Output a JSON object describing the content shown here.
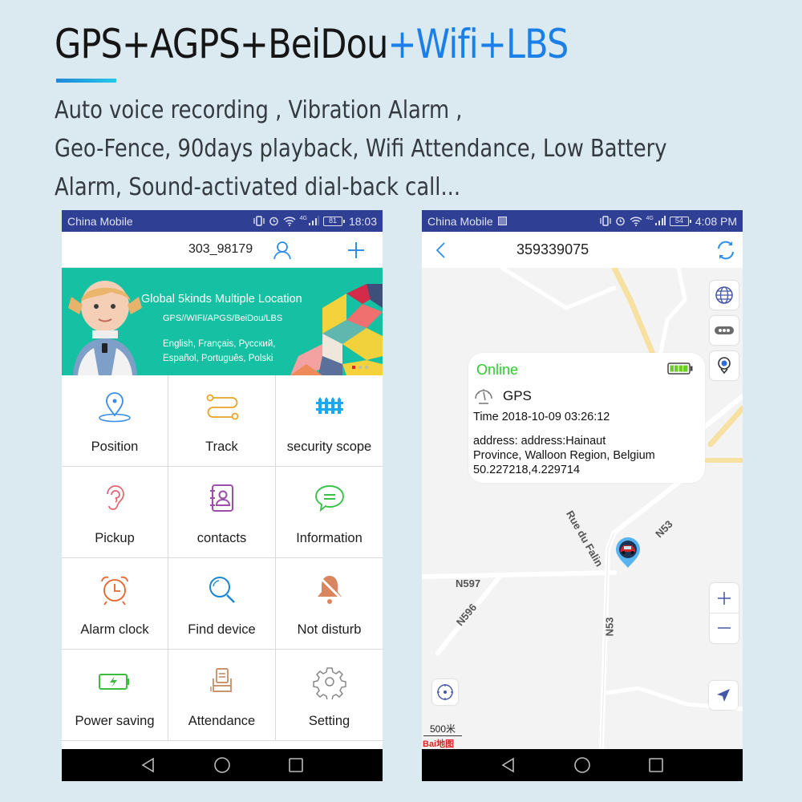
{
  "headline": {
    "part1": "GPS+AGPS+BeiDou",
    "part2": "+Wifi+LBS",
    "accent_color": "#1a7fe6"
  },
  "features": [
    "Auto voice recording , Vibration Alarm ,",
    "Geo-Fence, 90days playback, Wifi Attendance, Low Battery",
    "Alarm, Sound-activated dial-back call..."
  ],
  "left_phone": {
    "statusbar": {
      "carrier": "China Mobile",
      "network": "4G",
      "battery": "81",
      "time": "18:03"
    },
    "header": {
      "device_id": "303_98179",
      "user_icon": "user-icon",
      "add_icon": "plus-icon"
    },
    "banner": {
      "title": "Global 5kinds Multiple Location",
      "subtitle": "GPS//WIFI/APGS/BeiDou/LBS",
      "languages_line1": "English, Français, Русский,",
      "languages_line2": "Español, Português, Polski",
      "slide_count": 3,
      "active_slide": 1
    },
    "menu": [
      {
        "label": "Position",
        "icon": "location-pin-icon",
        "color": "#3a8ee6"
      },
      {
        "label": "Track",
        "icon": "track-route-icon",
        "color": "#e8a628"
      },
      {
        "label": "security scope",
        "icon": "fence-icon",
        "color": "#1aa9f0"
      },
      {
        "label": "Pickup",
        "icon": "ear-icon",
        "color": "#e06470"
      },
      {
        "label": "contacts",
        "icon": "contacts-book-icon",
        "color": "#9c4fa8"
      },
      {
        "label": "Information",
        "icon": "message-bubble-icon",
        "color": "#39c24a"
      },
      {
        "label": "Alarm clock",
        "icon": "alarm-clock-icon",
        "color": "#e8642a"
      },
      {
        "label": "Find device",
        "icon": "magnifier-icon",
        "color": "#1a86d0"
      },
      {
        "label": "Not disturb",
        "icon": "bell-muted-icon",
        "color": "#d98560"
      },
      {
        "label": "Power saving",
        "icon": "battery-charging-icon",
        "color": "#3fbb3f"
      },
      {
        "label": "Attendance",
        "icon": "attendance-machine-icon",
        "color": "#c99470"
      },
      {
        "label": "Setting",
        "icon": "gear-icon",
        "color": "#888888"
      }
    ]
  },
  "right_phone": {
    "statusbar": {
      "carrier": "China Mobile",
      "network": "4G",
      "battery": "54",
      "time": "4:08 PM"
    },
    "header": {
      "device_id": "359339075"
    },
    "popup": {
      "status": "Online",
      "battery_level": 1.0,
      "mode": "GPS",
      "time": "Time 2018-10-09 03:26:12",
      "address_line1": "address: address:Hainaut",
      "address_line2": "Province, Walloon Region, Belgium",
      "coordinates": "50.227218,4.229714"
    },
    "map": {
      "road_labels": [
        "Rue du Falin",
        "N53",
        "N597",
        "N596",
        "N53"
      ],
      "scale": "500米",
      "provider": "Bai地图"
    }
  }
}
